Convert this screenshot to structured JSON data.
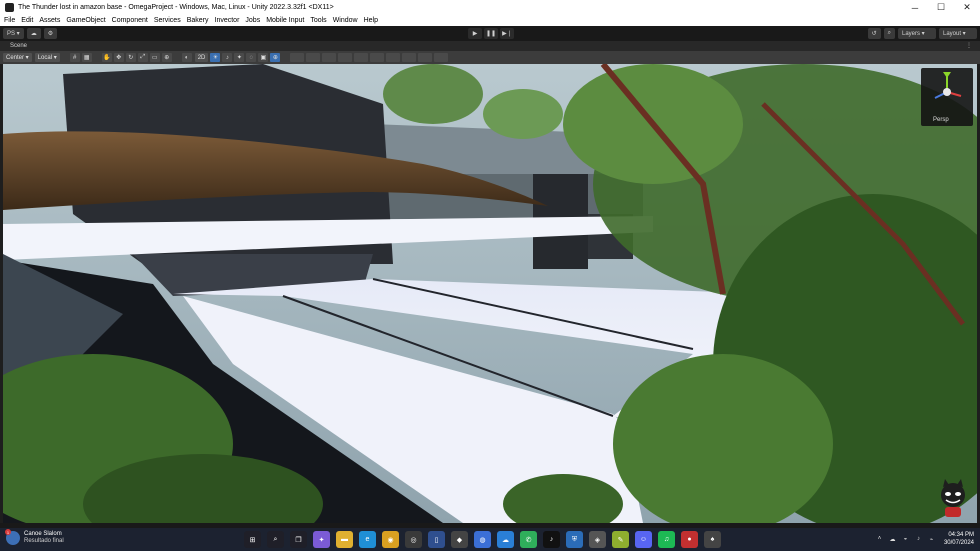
{
  "window": {
    "title": "The Thunder lost in amazon base - OmegaProject - Windows, Mac, Linux - Unity 2022.3.32f1 <DX11>",
    "minimize_glyph": "─",
    "maximize_glyph": "☐",
    "close_glyph": "✕"
  },
  "menu": [
    "File",
    "Edit",
    "Assets",
    "GameObject",
    "Component",
    "Services",
    "Bakery",
    "Invector",
    "Jobs",
    "Mobile Input",
    "Tools",
    "Window",
    "Help"
  ],
  "toolbar": {
    "account_label": "PS ▾",
    "cloud_icon": "☁",
    "collab_icon": "⚙",
    "play_icon": "▶",
    "pause_icon": "❚❚",
    "step_icon": "▶❘",
    "history_icon": "↺",
    "search_icon": "⌕",
    "layers_label": "Layers ▾",
    "layout_label": "Layout ▾"
  },
  "scene_tab": {
    "label": "Scene",
    "menu_icon": "⋮"
  },
  "scene_tools": {
    "pivot_label": "Center ▾",
    "space_label": "Local ▾",
    "view_2d_label": "2D",
    "tool_icons": [
      "✋",
      "✥",
      "↻",
      "⤢",
      "▭",
      "⊕"
    ]
  },
  "gizmo": {
    "projection_label": "Persp"
  },
  "taskbar": {
    "weather_badge": "1",
    "weather_title": "Canoe Slalom",
    "weather_subtitle": "Resultado final",
    "time": "04:34 PM",
    "date": "30/07/2024",
    "apps": [
      {
        "name": "windows-start-icon",
        "glyph": "⊞",
        "color": "#1f1f28"
      },
      {
        "name": "search-icon",
        "glyph": "⌕",
        "color": "#1f1f28"
      },
      {
        "name": "task-view-icon",
        "glyph": "❐",
        "color": "#1f1f28"
      },
      {
        "name": "copilot-icon",
        "glyph": "✦",
        "color": "#7b5bd6"
      },
      {
        "name": "file-explorer-icon",
        "glyph": "▬",
        "color": "#e0b030"
      },
      {
        "name": "edge-icon",
        "glyph": "e",
        "color": "#1f8fd6"
      },
      {
        "name": "chrome-icon",
        "glyph": "◉",
        "color": "#d9a021"
      },
      {
        "name": "camera-icon",
        "glyph": "◎",
        "color": "#3a3a3a"
      },
      {
        "name": "tablet-icon",
        "glyph": "▯",
        "color": "#2f4f8f"
      },
      {
        "name": "unity-hub-icon",
        "glyph": "◆",
        "color": "#444444"
      },
      {
        "name": "vpn-icon",
        "glyph": "◍",
        "color": "#3b6fd6"
      },
      {
        "name": "onedrive-icon",
        "glyph": "☁",
        "color": "#2a7fd6"
      },
      {
        "name": "whatsapp-icon",
        "glyph": "✆",
        "color": "#2fae5b"
      },
      {
        "name": "tiktok-icon",
        "glyph": "♪",
        "color": "#111111"
      },
      {
        "name": "security-icon",
        "glyph": "⛨",
        "color": "#2b6cb8"
      },
      {
        "name": "unity-icon",
        "glyph": "◈",
        "color": "#555555"
      },
      {
        "name": "notes-icon",
        "glyph": "✎",
        "color": "#8fae2f"
      },
      {
        "name": "discord-icon",
        "glyph": "☺",
        "color": "#5865f2"
      },
      {
        "name": "spotify-icon",
        "glyph": "♫",
        "color": "#1db954"
      },
      {
        "name": "media-icon",
        "glyph": "●",
        "color": "#c23030"
      },
      {
        "name": "game-icon",
        "glyph": "♠",
        "color": "#444444"
      }
    ],
    "tray": [
      "˄",
      "☁",
      "◒",
      "♪",
      "⌁"
    ]
  }
}
